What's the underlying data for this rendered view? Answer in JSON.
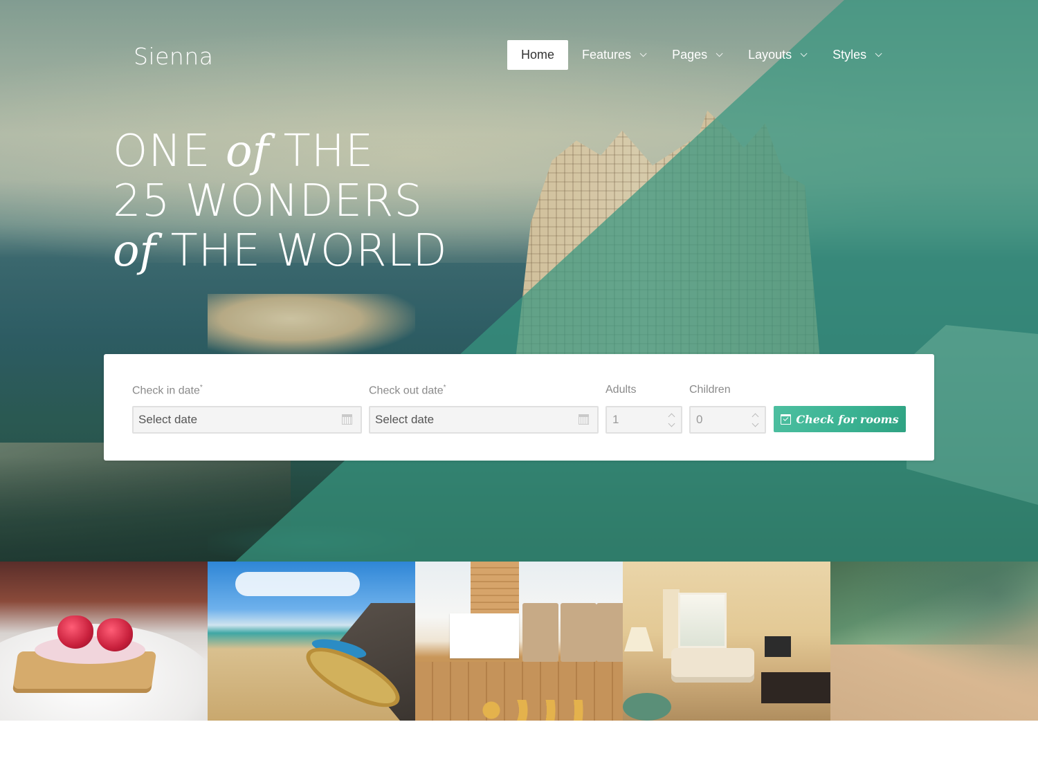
{
  "brand": {
    "name": "Sienna"
  },
  "nav": {
    "items": [
      {
        "label": "Home",
        "active": true,
        "has_dropdown": false
      },
      {
        "label": "Features",
        "active": false,
        "has_dropdown": true
      },
      {
        "label": "Pages",
        "active": false,
        "has_dropdown": true
      },
      {
        "label": "Layouts",
        "active": false,
        "has_dropdown": true
      },
      {
        "label": "Styles",
        "active": false,
        "has_dropdown": true
      }
    ]
  },
  "hero": {
    "line1": {
      "a": "ONE",
      "b": "of",
      "c": "THE"
    },
    "line2": {
      "a": "25 WONDERS"
    },
    "line3": {
      "b": "of",
      "c": "THE WORLD"
    }
  },
  "booking": {
    "check_in": {
      "label": "Check in date",
      "required_mark": "*",
      "placeholder": "Select date",
      "icon": "calendar-icon"
    },
    "check_out": {
      "label": "Check out date",
      "required_mark": "*",
      "placeholder": "Select date",
      "icon": "calendar-icon"
    },
    "adults": {
      "label": "Adults",
      "value": "1"
    },
    "children": {
      "label": "Children",
      "value": "0"
    },
    "submit": {
      "label": "Check for rooms",
      "icon": "calendar-check-icon"
    }
  },
  "gallery": {
    "tiles": [
      {
        "subject": "raspberry dessert on plate"
      },
      {
        "subject": "beach with boats"
      },
      {
        "subject": "cafe counter with muffins"
      },
      {
        "subject": "hotel room living area"
      },
      {
        "subject": "aerial beach view"
      }
    ]
  },
  "colors": {
    "accent": "#3bb393",
    "overlay_teal": "#389680",
    "card_bg": "#ffffff",
    "label_text": "#8a8a8a"
  }
}
